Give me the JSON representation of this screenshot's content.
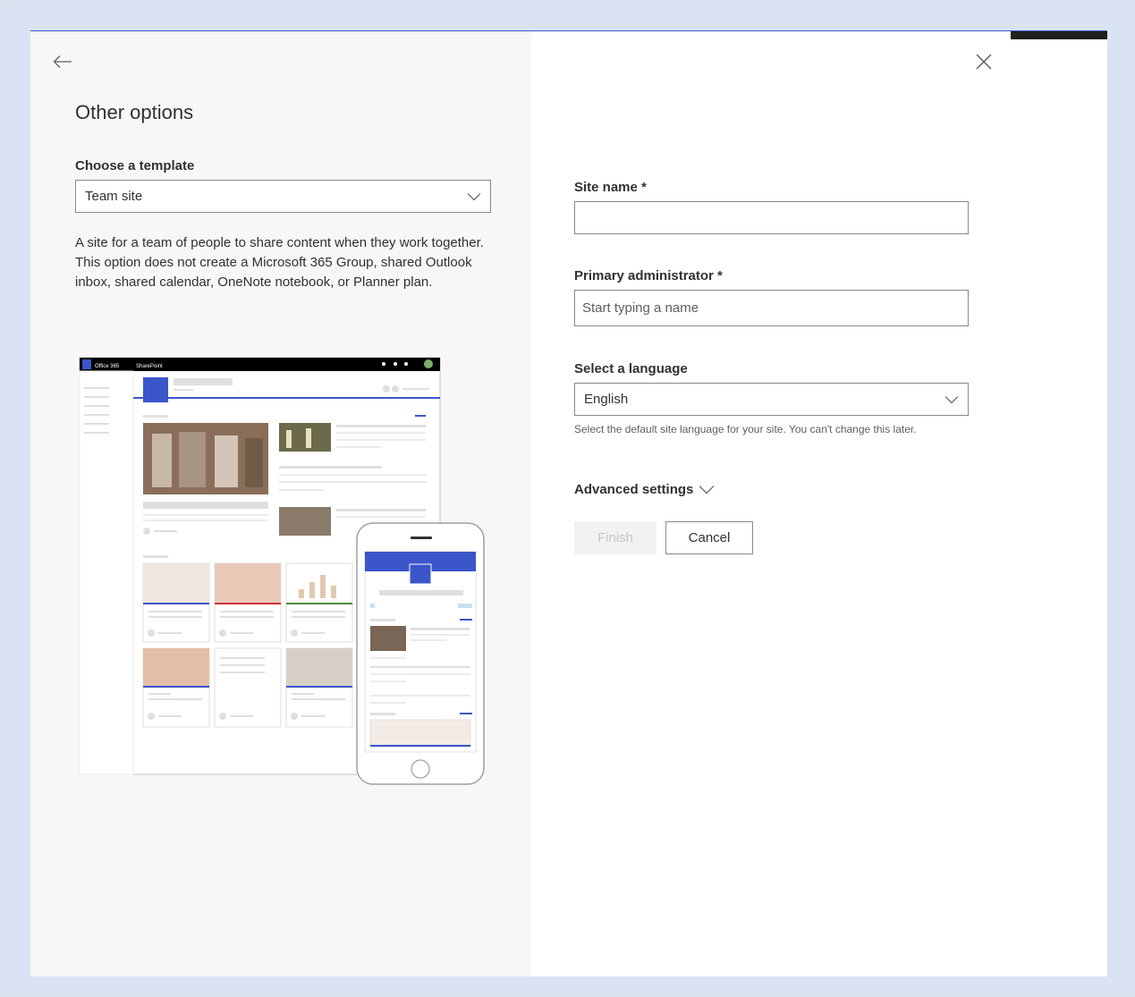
{
  "dialog": {
    "title": "Other options",
    "back_icon": "arrow-left-icon",
    "close_icon": "close-icon"
  },
  "template": {
    "label": "Choose a template",
    "selected": "Team site",
    "description": "A site for a team of people to share content when they work together. This option does not create a Microsoft 365 Group, shared Outlook inbox, shared calendar, OneNote notebook, or Planner plan."
  },
  "preview": {
    "app_name": "Office 365",
    "product_name": "SharePoint"
  },
  "form": {
    "site_name_label": "Site name *",
    "site_name_value": "",
    "admin_label": "Primary administrator *",
    "admin_placeholder": "Start typing a name",
    "language_label": "Select a language",
    "language_selected": "English",
    "language_help": "Select the default site language for your site. You can't change this later.",
    "advanced_label": "Advanced settings"
  },
  "buttons": {
    "finish": "Finish",
    "cancel": "Cancel"
  },
  "colors": {
    "accent": "#3a56c9",
    "pane_bg": "#f8f7f6",
    "disabled_text": "#c8c6c4"
  }
}
